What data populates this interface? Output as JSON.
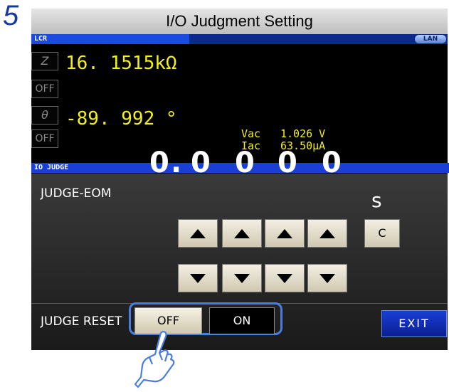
{
  "step": {
    "number": "5"
  },
  "banner": {
    "title": "I/O Judgment Setting"
  },
  "lcr": {
    "label": "LCR",
    "lan_badge": "LAN",
    "param1": {
      "symbol": "Z",
      "state": "OFF",
      "value": "16. 1515kΩ"
    },
    "param2": {
      "symbol": "θ",
      "state": "OFF",
      "value": "-89. 992 °"
    },
    "monitor": [
      {
        "name": "Vac",
        "value": "1.026 V"
      },
      {
        "name": "Iac",
        "value": "63.50μA"
      }
    ]
  },
  "io_judge": {
    "label": "IO JUDGE",
    "eom_label": "JUDGE-EOM",
    "eom_digits": [
      "0",
      ".",
      "0",
      "0",
      "0",
      "0"
    ],
    "eom_unit": "s",
    "clear_label": "C",
    "reset_label": "JUDGE RESET",
    "off_label": "OFF",
    "on_label": "ON",
    "exit_label": "EXIT",
    "selected": "OFF"
  },
  "icons": {
    "up": "arrow-up-icon",
    "down": "arrow-down-icon",
    "pointer": "pointing-hand-icon"
  },
  "colors": {
    "accent": "#1a3fd6",
    "highlight": "#4a7de0",
    "measure": "#f2ef1c",
    "step": "#1a3a9a"
  }
}
